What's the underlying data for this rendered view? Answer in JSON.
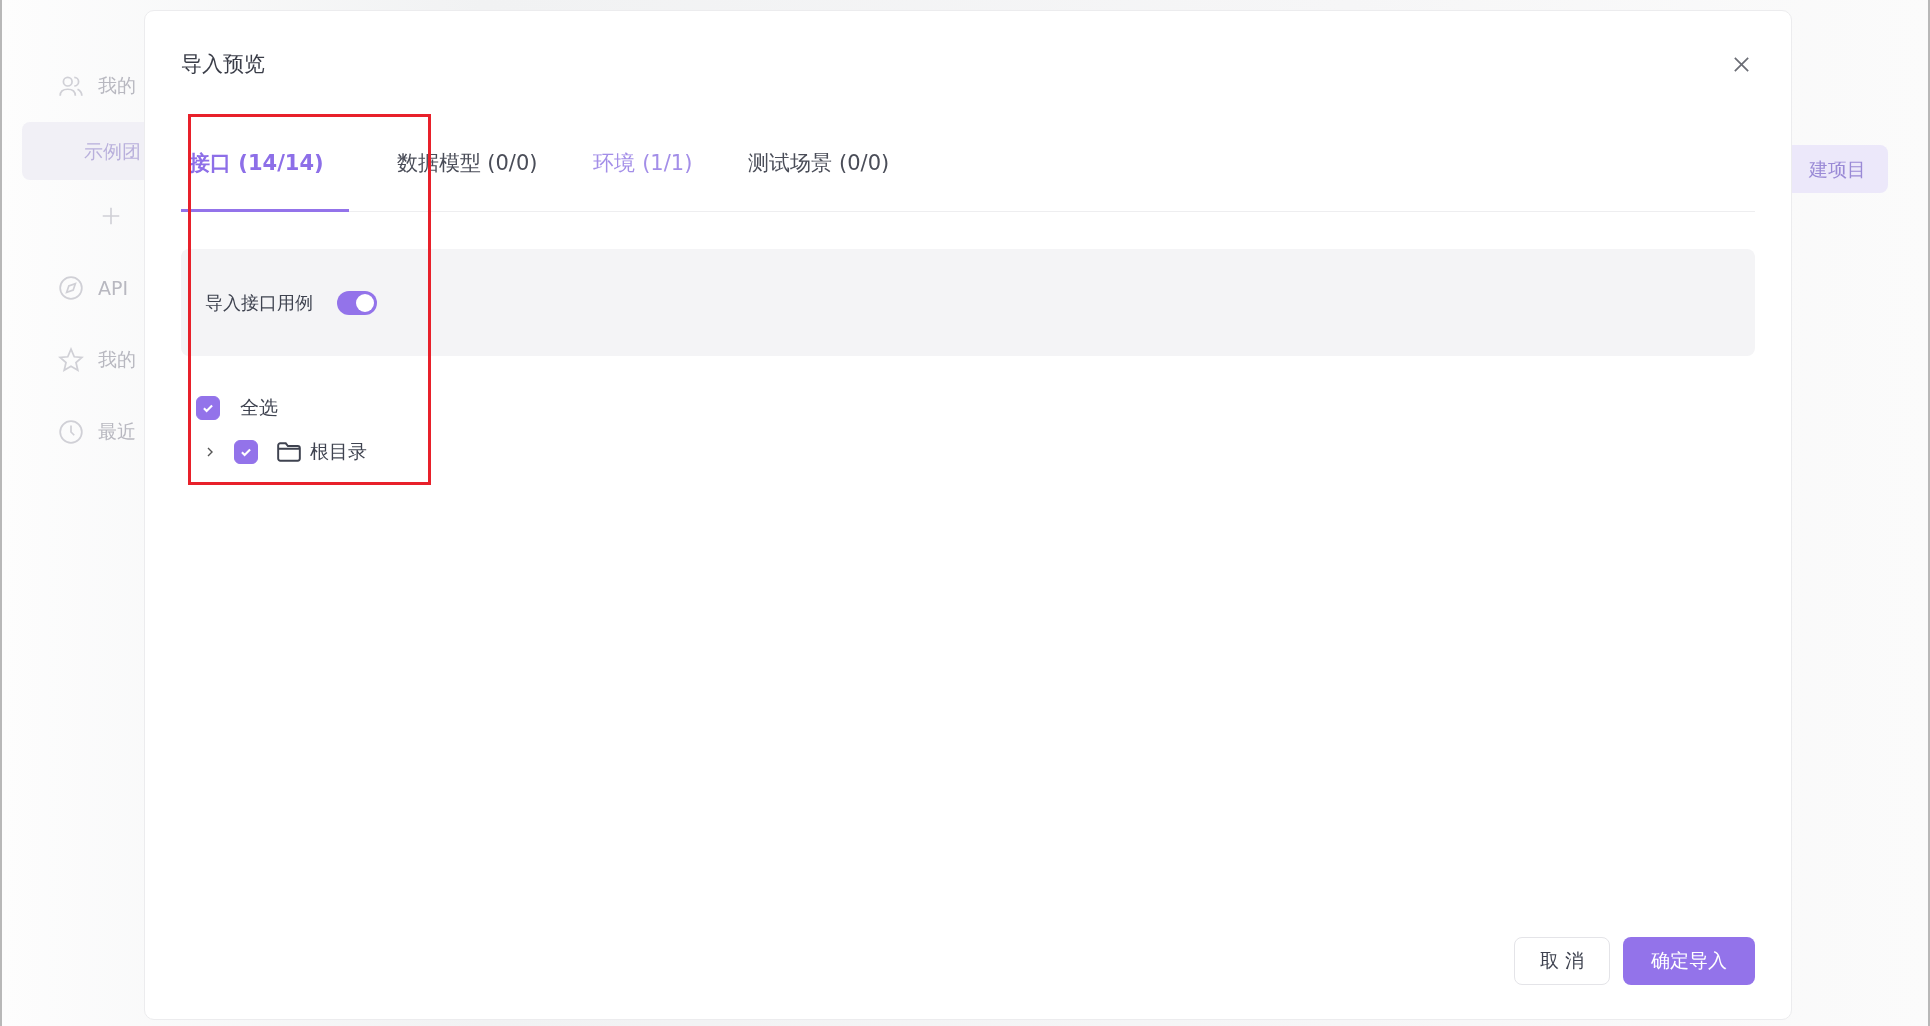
{
  "background": {
    "sidebar": [
      {
        "kind": "group",
        "label": "我的",
        "selected": false
      },
      {
        "kind": "team",
        "label": "示例团",
        "selected": true
      },
      {
        "kind": "add",
        "selected": false
      },
      {
        "kind": "compass",
        "label": "API",
        "selected": false
      },
      {
        "kind": "star",
        "label": "我的",
        "selected": false
      },
      {
        "kind": "clock",
        "label": "最近",
        "selected": false
      }
    ],
    "new_button": "建项目"
  },
  "dialog": {
    "title": "导入预览",
    "tabs": [
      {
        "label": "接口 (14/14)",
        "selected": true,
        "hovered": false
      },
      {
        "label": "数据模型 (0/0)",
        "selected": false,
        "hovered": false
      },
      {
        "label": "环境 (1/1)",
        "selected": false,
        "hovered": true
      },
      {
        "label": "测试场景 (0/0)",
        "selected": false,
        "hovered": false
      }
    ],
    "option": {
      "label": "导入接口用例",
      "on": true
    },
    "select_all": {
      "label": "全选",
      "checked": true
    },
    "tree": [
      {
        "label": "根目录",
        "checked": true,
        "expanded": false
      }
    ],
    "buttons": [
      {
        "kind": "secondary",
        "label": "取 消"
      },
      {
        "kind": "primary",
        "label": "确定导入"
      }
    ]
  },
  "annotation": {
    "kind": "highlight"
  }
}
